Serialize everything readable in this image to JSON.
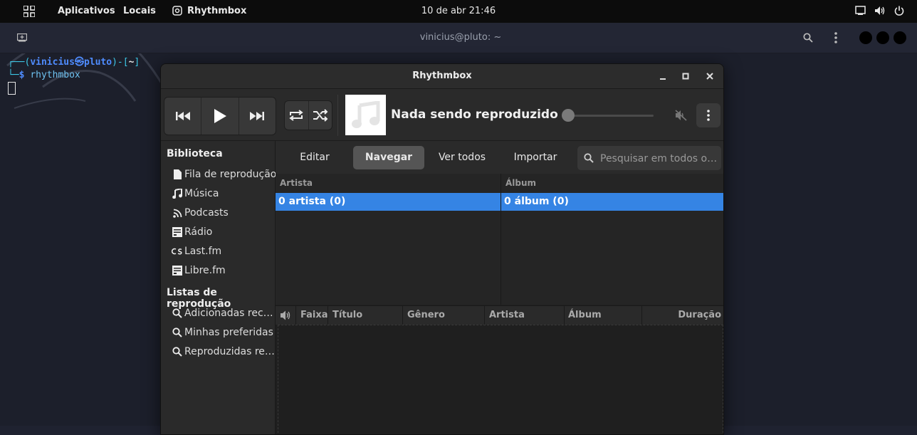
{
  "topbar": {
    "apps_label": "Aplicativos",
    "places_label": "Locais",
    "active_app": "Rhythmbox",
    "clock": "10 de abr  21:46"
  },
  "terminal": {
    "title": "vinicius@pluto: ~",
    "prompt_user": "vinicius",
    "prompt_host": "pluto",
    "prompt_dir": "~",
    "command": "rhythmbox"
  },
  "rhythmbox": {
    "title": "Rhythmbox",
    "now_playing": "Nada sendo reproduzido",
    "sidebar": {
      "library_heading": "Biblioteca",
      "library_items": [
        {
          "label": "Fila de reprodução",
          "icon": "document-icon"
        },
        {
          "label": "Música",
          "icon": "music-note-icon"
        },
        {
          "label": "Podcasts",
          "icon": "rss-icon"
        },
        {
          "label": "Rádio",
          "icon": "radio-icon"
        },
        {
          "label": "Last.fm",
          "icon": "lastfm-icon"
        },
        {
          "label": "Libre.fm",
          "icon": "radio-icon"
        }
      ],
      "playlists_heading": "Listas de reprodução",
      "playlist_items": [
        {
          "label": "Adicionadas rec…",
          "icon": "search-icon"
        },
        {
          "label": "Minhas preferidas",
          "icon": "search-icon"
        },
        {
          "label": "Reproduzidas re…",
          "icon": "search-icon"
        }
      ]
    },
    "nav": {
      "edit": "Editar",
      "browse": "Navegar",
      "view_all": "Ver todos",
      "import": "Importar",
      "search_placeholder": "Pesquisar em todos o…"
    },
    "browser": {
      "artist_header": "Artista",
      "album_header": "Álbum",
      "artist_selected": "0 artista (0)",
      "album_selected": "0 álbum (0)"
    },
    "tracklist": {
      "columns": [
        "Faixa",
        "Título",
        "Gênero",
        "Artista",
        "Álbum",
        "Duração"
      ]
    },
    "colors": {
      "accent": "#3584e4",
      "window_bg": "#242424"
    }
  }
}
